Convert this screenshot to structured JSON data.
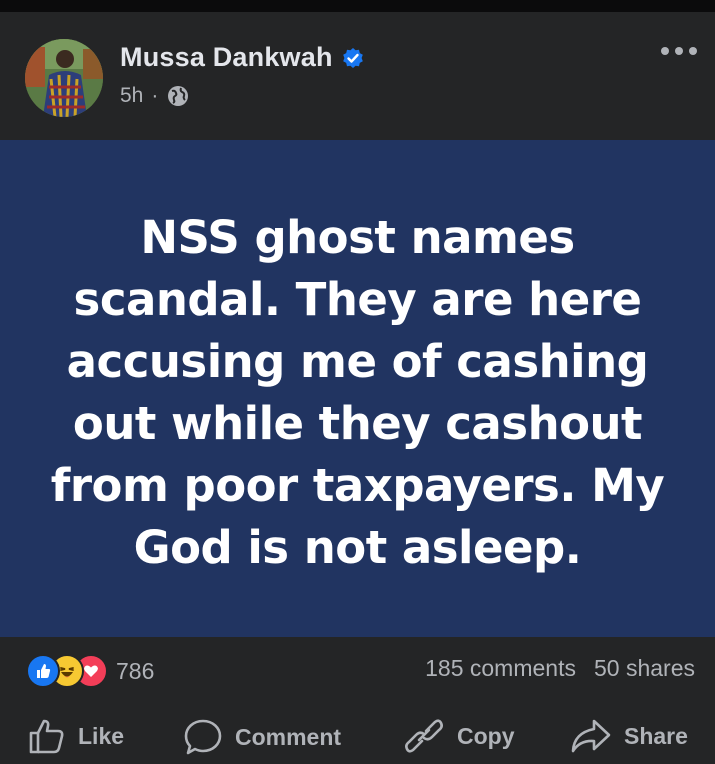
{
  "post": {
    "author": "Mussa Dankwah",
    "time": "5h",
    "separator": "·",
    "privacy_icon": "globe-icon",
    "verified_icon": "verified-badge-icon",
    "menu_icon": "more-options-icon",
    "text": "NSS ghost names scandal. They are here accusing me of cashing out while they cashout from poor taxpayers. My God is not asleep.",
    "background_color": "#213461"
  },
  "engagement": {
    "reaction_icons": [
      "like-icon",
      "haha-icon",
      "love-icon"
    ],
    "reaction_count": "786",
    "comments": "185 comments",
    "shares": "50 shares"
  },
  "actions": {
    "like": "Like",
    "comment": "Comment",
    "copy": "Copy",
    "share": "Share"
  },
  "colors": {
    "card_bg": "#242526",
    "accent_blue": "#1877f2",
    "text_primary": "#e4e6eb",
    "text_secondary": "#b0b3b8"
  }
}
